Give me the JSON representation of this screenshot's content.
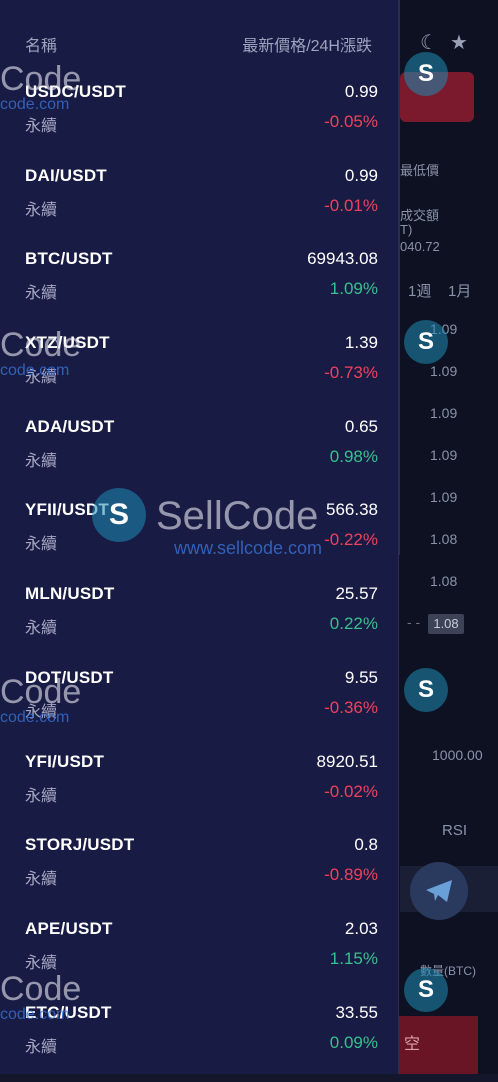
{
  "header": {
    "name_label": "名稱",
    "price_label": "最新價格/24H漲跌"
  },
  "background": {
    "labels": [
      "最低價",
      "成交額",
      "T)",
      "040.72",
      "1週",
      "1月",
      "1000.00",
      "RSI",
      "數量(BTC)",
      "空"
    ],
    "prices": [
      "1.09",
      "1.09",
      "1.09",
      "1.09",
      "1.09",
      "1.08",
      "1.08"
    ],
    "badge": "1.08",
    "icons": [
      "moon-icon",
      "star-icon",
      "telegram-icon"
    ]
  },
  "pairs": [
    {
      "pair": "USDC/USDT",
      "type": "永續",
      "price": "0.99",
      "change": "-0.05%",
      "direction": "down"
    },
    {
      "pair": "DAI/USDT",
      "type": "永續",
      "price": "0.99",
      "change": "-0.01%",
      "direction": "down"
    },
    {
      "pair": "BTC/USDT",
      "type": "永續",
      "price": "69943.08",
      "change": "1.09%",
      "direction": "up"
    },
    {
      "pair": "XTZ/USDT",
      "type": "永續",
      "price": "1.39",
      "change": "-0.73%",
      "direction": "down"
    },
    {
      "pair": "ADA/USDT",
      "type": "永續",
      "price": "0.65",
      "change": "0.98%",
      "direction": "up"
    },
    {
      "pair": "YFII/USDT",
      "type": "永續",
      "price": "566.38",
      "change": "-0.22%",
      "direction": "down"
    },
    {
      "pair": "MLN/USDT",
      "type": "永續",
      "price": "25.57",
      "change": "0.22%",
      "direction": "up"
    },
    {
      "pair": "DOT/USDT",
      "type": "永續",
      "price": "9.55",
      "change": "-0.36%",
      "direction": "down"
    },
    {
      "pair": "YFI/USDT",
      "type": "永續",
      "price": "8920.51",
      "change": "-0.02%",
      "direction": "down"
    },
    {
      "pair": "STORJ/USDT",
      "type": "永續",
      "price": "0.8",
      "change": "-0.89%",
      "direction": "down"
    },
    {
      "pair": "APE/USDT",
      "type": "永續",
      "price": "2.03",
      "change": "1.15%",
      "direction": "up"
    },
    {
      "pair": "ETC/USDT",
      "type": "永續",
      "price": "33.55",
      "change": "0.09%",
      "direction": "up"
    }
  ],
  "colors": {
    "up": "#36c18f",
    "down": "#f0415c",
    "drawer": "#181b43"
  },
  "watermark": {
    "brand": "SellCode",
    "short": "Code",
    "url": "www.sellcode.com",
    "short_url": "code.com"
  }
}
